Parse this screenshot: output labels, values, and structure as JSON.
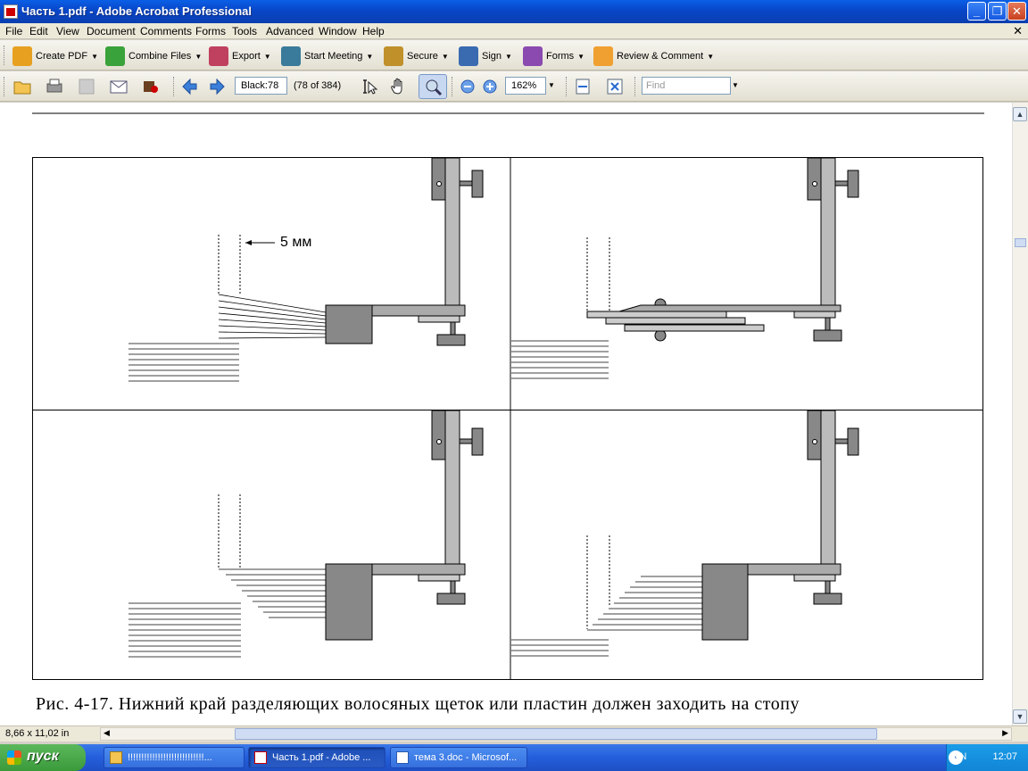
{
  "window": {
    "title": "Часть 1.pdf - Adobe Acrobat Professional",
    "buttons": [
      "_",
      "❐",
      "✕"
    ]
  },
  "menubar": {
    "items": [
      "File",
      "Edit",
      "View",
      "Document",
      "Comments",
      "Forms",
      "Tools",
      "Advanced",
      "Window",
      "Help"
    ],
    "close_doc": "✕"
  },
  "toolbar1": {
    "buttons": [
      {
        "label": "Create PDF",
        "icon": "create-pdf-icon",
        "color": "#e8a020"
      },
      {
        "label": "Combine Files",
        "icon": "combine-files-icon",
        "color": "#3aa23a"
      },
      {
        "label": "Export",
        "icon": "export-icon",
        "color": "#c04060"
      },
      {
        "label": "Start Meeting",
        "icon": "meeting-icon",
        "color": "#3a7a9a"
      },
      {
        "label": "Secure",
        "icon": "lock-icon",
        "color": "#c0902a"
      },
      {
        "label": "Sign",
        "icon": "pen-icon",
        "color": "#3a6ab0"
      },
      {
        "label": "Forms",
        "icon": "forms-icon",
        "color": "#8a4ab0"
      },
      {
        "label": "Review & Comment",
        "icon": "comment-icon",
        "color": "#f0a030"
      }
    ]
  },
  "toolbar2": {
    "page_field": "Black:78",
    "page_count": "(78 of 384)",
    "zoom": "162%",
    "find_placeholder": "Find"
  },
  "document": {
    "label_5mm": "5 мм",
    "caption": "Рис. 4-17. Нижний край разделяющих волосяных щеток или пластин должен заходить на стопу"
  },
  "status": {
    "page_size": "8,66 x 11,02 in"
  },
  "taskbar": {
    "start_label": "пуск",
    "tasks": [
      {
        "label": "!!!!!!!!!!!!!!!!!!!!!!!!!!!!...",
        "active": false
      },
      {
        "label": "Часть 1.pdf - Adobe ...",
        "active": true
      },
      {
        "label": "тема 3.doc - Microsof...",
        "active": false
      }
    ],
    "lang": "EN",
    "clock": "12:07"
  }
}
